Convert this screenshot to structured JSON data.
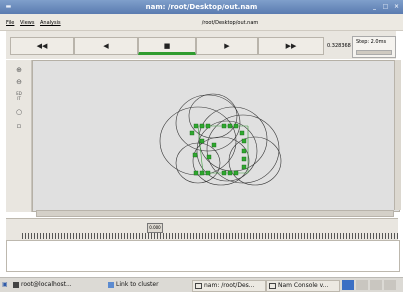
{
  "window": {
    "title": "nam: /root/Desktop/out.nam"
  },
  "menubar": {
    "items": [
      {
        "label": "File"
      },
      {
        "label": "Views"
      },
      {
        "label": "Analysis"
      }
    ],
    "file_path": "/root/Desktop/out.nam"
  },
  "controls": {
    "buttons": [
      {
        "label": "◀◀"
      },
      {
        "label": "◀"
      },
      {
        "label": "■"
      },
      {
        "label": "▶"
      },
      {
        "label": "▶▶"
      }
    ],
    "active_button": "■",
    "time": "0.328368",
    "step_label": "Step: 2.0ms"
  },
  "toolbar": {
    "icons": [
      "zoom-in-icon",
      "zoom-out-icon",
      "edit-icon",
      "node-icon",
      "pointer-icon"
    ],
    "edit_label": "ED\nIT"
  },
  "timeline": {
    "slider_label": "0.000"
  },
  "taskbar": {
    "items": [
      {
        "label": "root@localhost..."
      },
      {
        "label": "Link to cluster"
      },
      {
        "label": "nam: /root/Des..."
      },
      {
        "label": "Nam Console v..."
      }
    ]
  },
  "colors": {
    "node": "#2fa82f",
    "title_bar": "#6b8cc1",
    "canvas_bg": "#e0e0e0"
  }
}
